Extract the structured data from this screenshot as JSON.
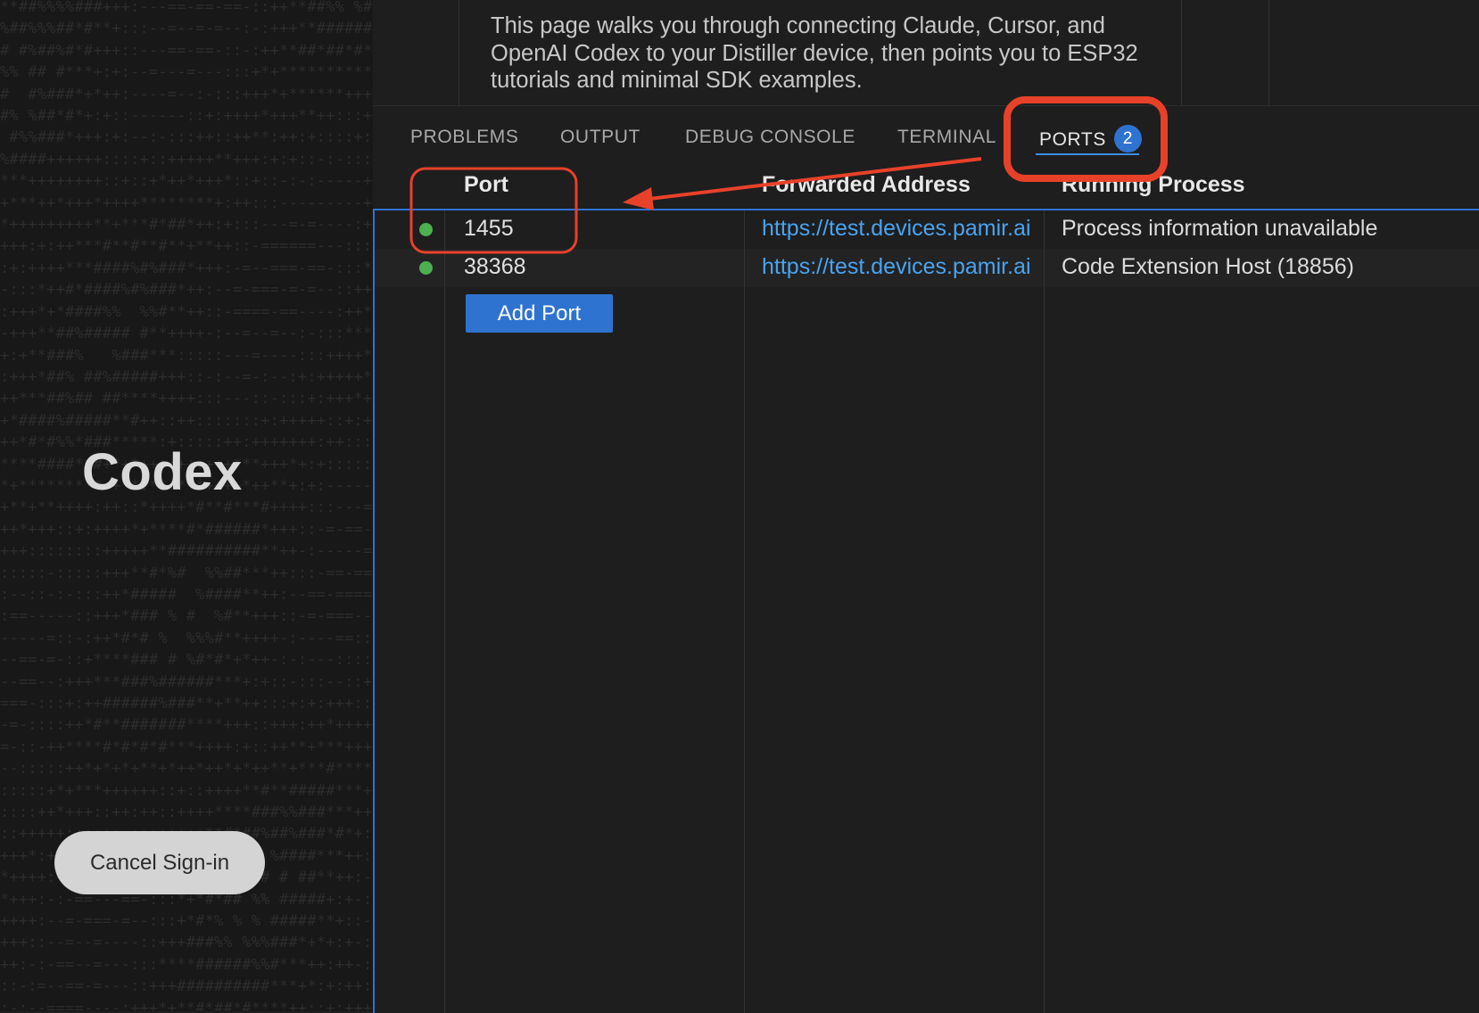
{
  "signin": {
    "title": "Codex",
    "cancel_label": "Cancel Sign-in"
  },
  "doc": {
    "text": "This page walks you through connecting Claude, Cursor, and OpenAI Codex to your Distiller device, then points you to ESP32 tutorials and minimal SDK examples."
  },
  "panel": {
    "tabs": [
      "PROBLEMS",
      "OUTPUT",
      "DEBUG CONSOLE",
      "TERMINAL",
      "PORTS"
    ],
    "ports_badge": "2",
    "active_tab": "PORTS"
  },
  "ports": {
    "headers": {
      "port": "Port",
      "address": "Forwarded Address",
      "process": "Running Process"
    },
    "rows": [
      {
        "port": "1455",
        "address": "https://test.devices.pamir.ai",
        "process": "Process information unavailable",
        "status": "running"
      },
      {
        "port": "38368",
        "address": "https://test.devices.pamir.ai",
        "process": "Code Extension Host (18856)",
        "status": "running"
      }
    ],
    "add_port_label": "Add Port"
  },
  "colors": {
    "accent": "#2f73d1",
    "link": "#4aa3f0",
    "status_running": "#4caf50",
    "annotation": "#e8412a"
  }
}
